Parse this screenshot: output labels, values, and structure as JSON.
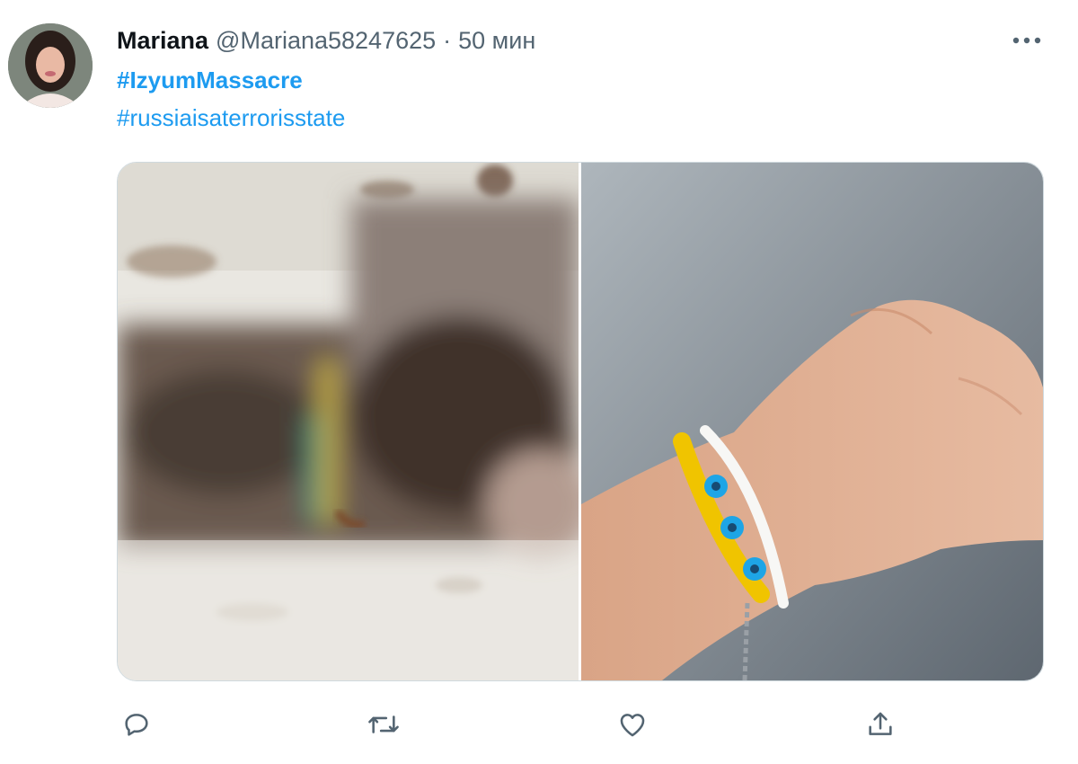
{
  "tweet": {
    "author_name": "Mariana",
    "handle": "@Mariana58247625",
    "separator": "·",
    "time": "50 мин",
    "hashtags": [
      "#IzyumMassacre",
      "#russiaisaterrorisstate"
    ]
  },
  "icons": {
    "more": "more-horizontal-icon",
    "reply": "reply-icon",
    "retweet": "retweet-icon",
    "like": "heart-icon",
    "share": "share-icon"
  },
  "colors": {
    "link": "#1d9bf0",
    "text": "#0f1419",
    "secondary": "#536471"
  }
}
